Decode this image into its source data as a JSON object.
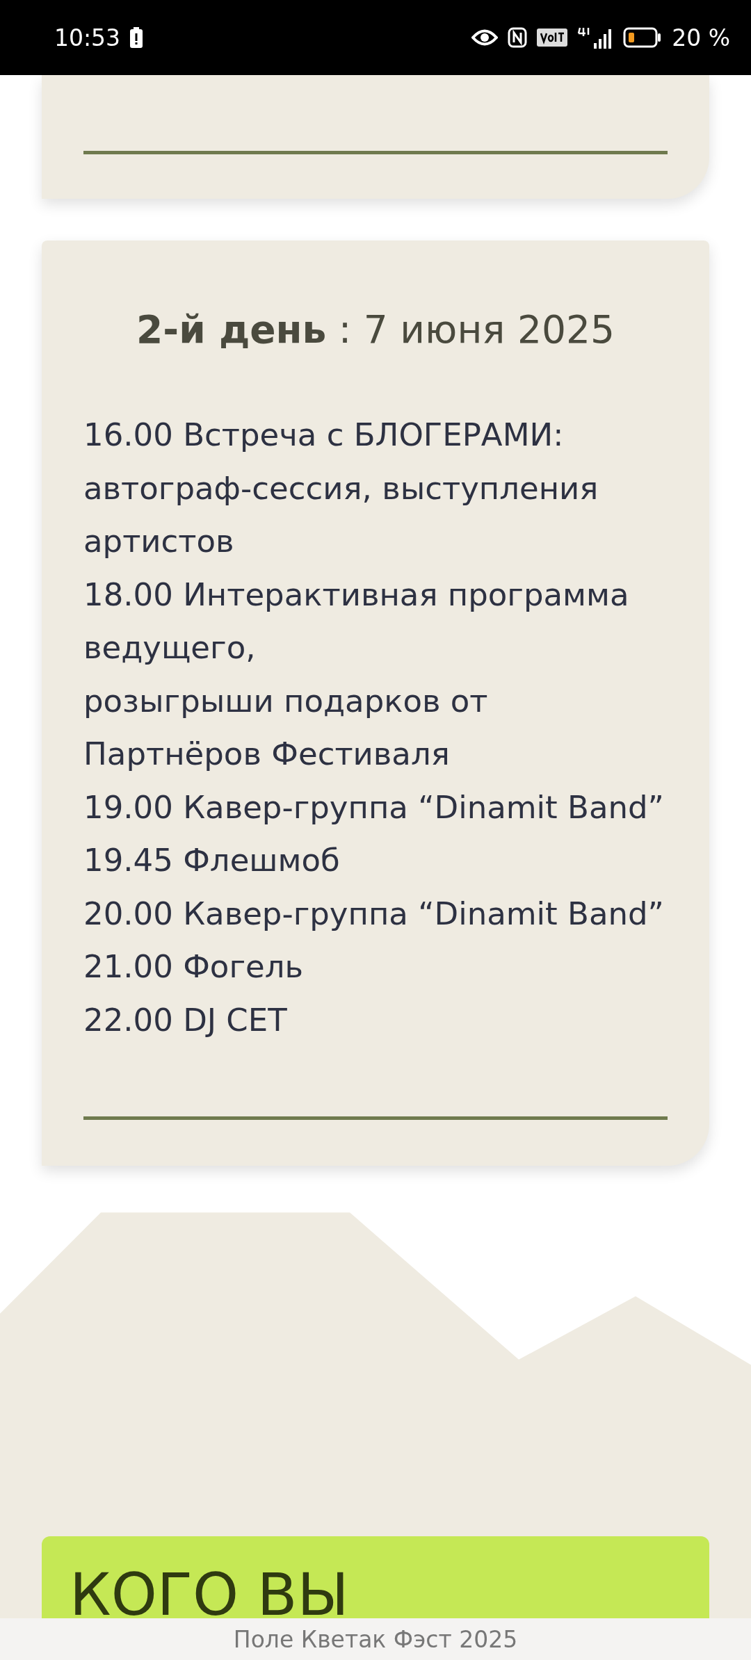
{
  "status_bar": {
    "time": "10:53",
    "battery": "20 %"
  },
  "day_card": {
    "title": "**2-й день** : 7 июня 2025",
    "lines": [
      "16.00 Встреча с БЛОГЕРАМИ:",
      "автограф-сессия, выступления",
      "артистов",
      "18.00 Интерактивная программа",
      "ведущего,",
      "розыгрыши подарков от",
      "Партнёров Фестиваля",
      "19.00 Кавер-группа “Dinamit Band”",
      "19.45 Флешмоб",
      "20.00 Кавер-группа “Dinamit Band”",
      "21.00 Фогель",
      "22.00 DJ CET"
    ]
  },
  "promo": {
    "heading": "КОГО ВЫ"
  },
  "footer": {
    "site": "Поле Кветак Фэст 2025"
  }
}
